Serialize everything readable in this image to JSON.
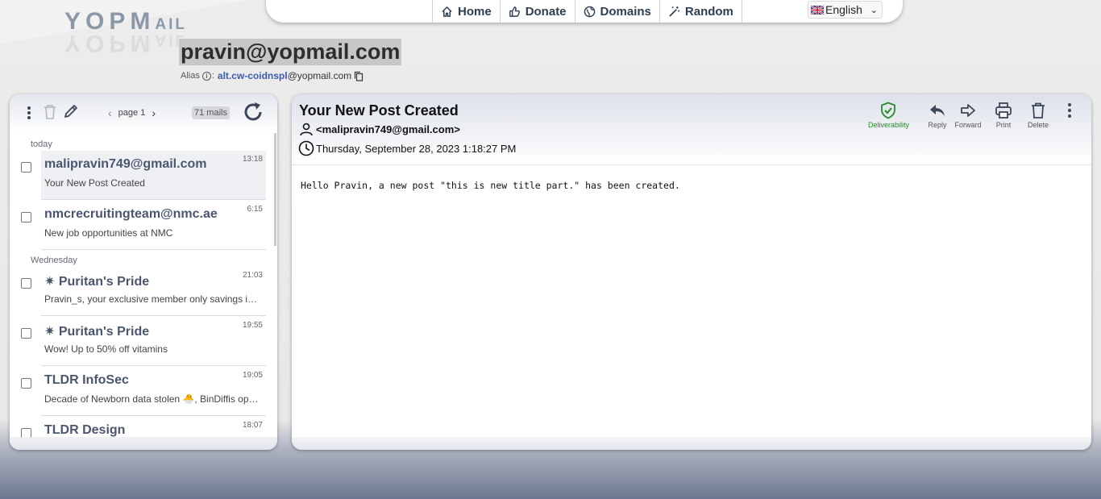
{
  "brand": {
    "logo_main": "YOPM",
    "logo_small": "AIL"
  },
  "nav": {
    "items": [
      {
        "label": "Home",
        "icon": "home-icon"
      },
      {
        "label": "Donate",
        "icon": "thumbs-up-icon"
      },
      {
        "label": "Domains",
        "icon": "globe-icon"
      },
      {
        "label": "Random",
        "icon": "magic-wand-icon"
      }
    ],
    "language": "English"
  },
  "mailbox": {
    "address": "pravin@yopmail.com",
    "alias_label": "Alias",
    "alias_name": "alt.cw-coidnspl",
    "alias_domain": "@yopmail.com"
  },
  "inbox": {
    "page_label": "page 1",
    "mail_count": "71 mails",
    "groups": [
      {
        "day": "today",
        "mails": [
          {
            "from": "malipravin749@gmail.com",
            "subject": "Your New Post Created",
            "time": "13:18"
          },
          {
            "from": "nmcrecruitingteam@nmc.ae",
            "subject": "New job opportunities at NMC",
            "time": "6:15"
          }
        ]
      },
      {
        "day": "Wednesday",
        "mails": [
          {
            "from": "✷ Puritan's Pride",
            "subject": "Pravin_s, your exclusive member only savings is…",
            "time": "21:03"
          },
          {
            "from": "✷ Puritan's Pride",
            "subject": "Wow! Up to 50% off vitamins",
            "time": "19:55"
          },
          {
            "from": "TLDR InfoSec",
            "subject": "Decade of Newborn data stolen 🐣, BinDiffis op…",
            "time": "19:05"
          },
          {
            "from": "TLDR Design",
            "subject": "",
            "time": "18:07"
          }
        ]
      }
    ]
  },
  "message": {
    "subject": "Your New Post Created",
    "from": "<malipravin749@gmail.com>",
    "date": "Thursday, September 28, 2023 1:18:27 PM",
    "body": "Hello Pravin, a new post \"this is new title part.\" has been created.",
    "actions": {
      "deliverability": "Deliverability",
      "reply": "Reply",
      "forward": "Forward",
      "print": "Print",
      "delete": "Delete"
    }
  },
  "colors": {
    "accent_link": "#3b5bb5",
    "deliverability_green": "#2a8a2a",
    "address_highlight": "#c7c7c7"
  }
}
